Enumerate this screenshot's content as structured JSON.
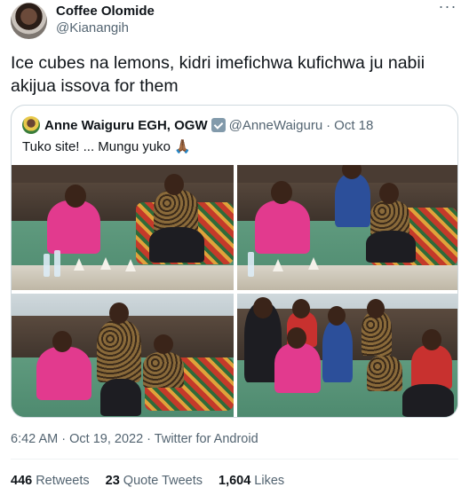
{
  "author": {
    "name": "Coffee Olomide",
    "handle": "@Kianangih"
  },
  "tweet": {
    "text": "Ice cubes na lemons, kidri imefichwa kufichwa ju nabii akijua issova for them"
  },
  "more_icon": "more-dots-icon",
  "quoted": {
    "name": "Anne Waiguru EGH, OGW",
    "handle": "@AnneWaiguru",
    "separator": "·",
    "date": "Oct 18",
    "text": "Tuko site! ... Mungu yuko 🙏🏾",
    "badge_icon": "verified-badge-icon",
    "photos": [
      "photo-1",
      "photo-2",
      "photo-3",
      "photo-4"
    ]
  },
  "meta": {
    "time": "6:42 AM",
    "sep1": "·",
    "date": "Oct 19, 2022",
    "sep2": "·",
    "source": "Twitter for Android"
  },
  "stats": [
    {
      "count": "446",
      "label": "Retweets"
    },
    {
      "count": "23",
      "label": "Quote Tweets"
    },
    {
      "count": "1,604",
      "label": "Likes"
    }
  ],
  "colors": {
    "text": "#0f1419",
    "secondary": "#536471",
    "border": "#cfd9de",
    "divider": "#eff3f4"
  }
}
